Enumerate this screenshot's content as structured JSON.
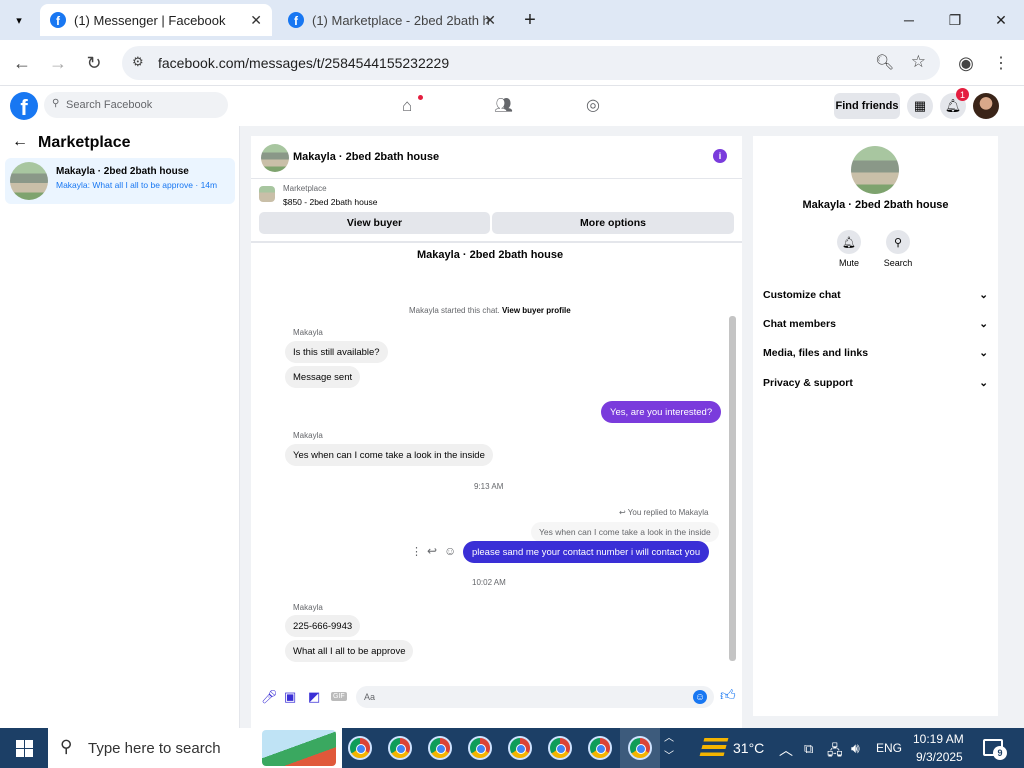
{
  "browser": {
    "tabs": [
      {
        "title": "(1) Messenger | Facebook"
      },
      {
        "title": "(1) Marketplace - 2bed 2bath h"
      }
    ],
    "url": "facebook.com/messages/t/2584544155232229",
    "new_tab": "+",
    "minimize": "─",
    "restore": "❐",
    "close": "✕"
  },
  "fb_header": {
    "logo": "f",
    "search_placeholder": "Search Facebook",
    "find_friends": "Find friends",
    "notification_count": "1"
  },
  "sidebar": {
    "title": "Marketplace",
    "conversation": {
      "name": "Makayla · 2bed 2bath house",
      "preview": "Makayla: What all I all to be approve · 14m"
    }
  },
  "chat": {
    "header_title": "Makayla · 2bed 2bath house",
    "listing_label": "Marketplace",
    "listing_price": "$850 - 2bed 2bath house",
    "view_buyer": "View buyer",
    "more_options": "More options",
    "thread_title": "Makayla · 2bed 2bath house",
    "started_text": "Makayla started this chat.",
    "view_buyer_profile": "View buyer profile",
    "messages": {
      "sender1": "Makayla",
      "m1": "Is this still available?",
      "m2": "Message sent",
      "m3": "Yes, are you interested?",
      "sender2": "Makayla",
      "m4": "Yes when can I come take a look in the inside",
      "time1": "9:13 AM",
      "replied_label": "You replied to Makayla",
      "quoted": "Yes when can I come take a look in the inside",
      "m5": "please sand me your contact number i will contact you",
      "time2": "10:02 AM",
      "sender3": "Makayla",
      "m6": "225-666-9943",
      "m7": "What all I all to be approve"
    },
    "composer_placeholder": "Aa",
    "gif": "GIF"
  },
  "details": {
    "name": "Makayla · 2bed 2bath house",
    "mute": "Mute",
    "search": "Search",
    "sections": [
      "Customize chat",
      "Chat members",
      "Media, files and links",
      "Privacy & support"
    ]
  },
  "taskbar": {
    "search_placeholder": "Type here to search",
    "weather": "31°C",
    "language": "ENG",
    "time": "10:19 AM",
    "date": "9/3/2025",
    "notif_count": "9"
  },
  "colors": {
    "facebook_blue": "#1877f2",
    "sent_bubble": "#7a3bdc",
    "taskbar": "#1c3f66"
  }
}
